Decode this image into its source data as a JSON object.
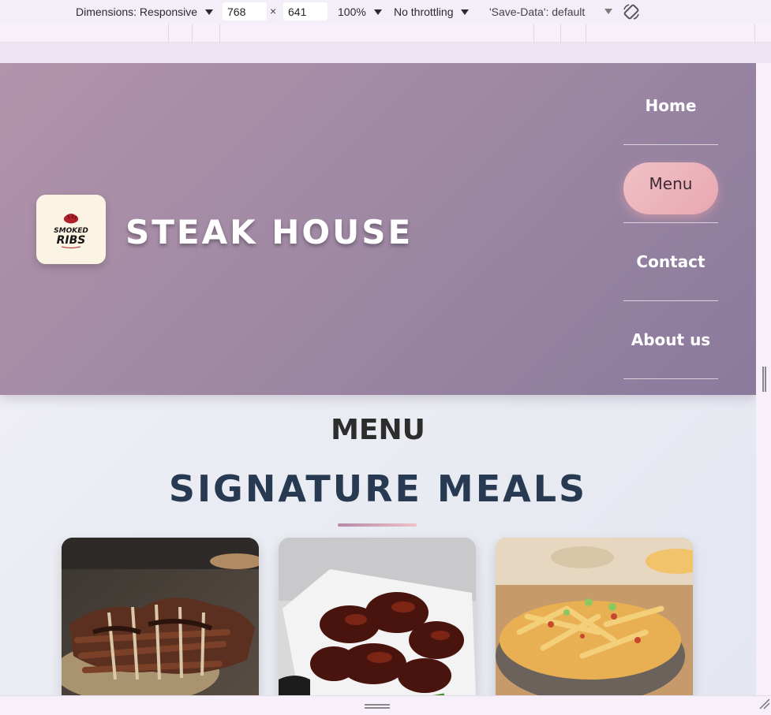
{
  "devtools": {
    "dimensions_label": "Dimensions: Responsive",
    "width_value": "768",
    "times": "×",
    "height_value": "641",
    "zoom": "100%",
    "throttling": "No throttling",
    "save_data": "'Save-Data': default"
  },
  "site": {
    "logo_text": "SMOKED RIBS",
    "brand": "STEAK HOUSE",
    "nav": [
      "Home",
      "Menu",
      "Contact",
      "About us"
    ],
    "active_nav": "Menu",
    "section_kicker": "MENU",
    "section_title": "SIGNATURE MEALS",
    "cards": [
      {
        "image": "bbq-ribs-photo"
      },
      {
        "image": "glazed-wings-photo"
      },
      {
        "image": "loaded-fries-photo"
      }
    ]
  },
  "colors": {
    "hero_start": "#b393aa",
    "hero_end": "#8a7a9c",
    "active_pill": "#eeb6bd",
    "title": "#273a52"
  }
}
